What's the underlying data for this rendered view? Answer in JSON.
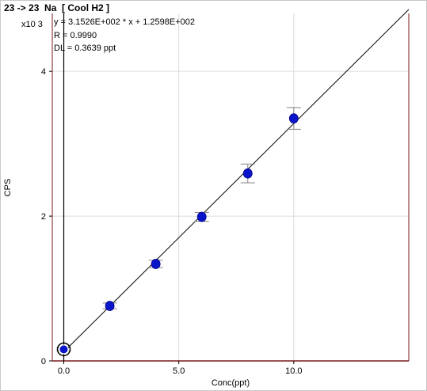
{
  "title": "23 -> 23  Na  [ Cool H2 ]",
  "chart_data": {
    "type": "scatter",
    "xlabel": "Conc(ppt)",
    "ylabel": "CPS",
    "y_multiplier": "x10 3",
    "xlim": [
      -0.5,
      15.0
    ],
    "ylim": [
      0,
      4.8
    ],
    "x_ticks": [
      0.0,
      5.0,
      10.0
    ],
    "x_tick_labels": [
      "0.0",
      "5.0",
      "10.0"
    ],
    "y_ticks": [
      0,
      2,
      4
    ],
    "y_tick_labels": [
      "0",
      "2",
      "4"
    ],
    "grid": true,
    "equation": "y = 3.1526E+002 * x  + 1.2598E+002",
    "r_text": "R =  0.9990",
    "dl_text": "DL = 0.3639 ppt",
    "fit": {
      "slope": 0.31526,
      "intercept": 0.12598
    },
    "points": [
      {
        "x": 0.0,
        "y": 0.16,
        "err": 0.02
      },
      {
        "x": 2.0,
        "y": 0.76,
        "err": 0.04
      },
      {
        "x": 4.0,
        "y": 1.34,
        "err": 0.05
      },
      {
        "x": 6.0,
        "y": 1.99,
        "err": 0.06
      },
      {
        "x": 8.0,
        "y": 2.59,
        "err": 0.13
      },
      {
        "x": 10.0,
        "y": 3.35,
        "err": 0.15
      }
    ],
    "colors": {
      "point": "#0a14c8",
      "axis": "#7a1a1a",
      "grid": "#dcdcdc",
      "fit": "#000000",
      "errorbar": "#888888"
    }
  }
}
